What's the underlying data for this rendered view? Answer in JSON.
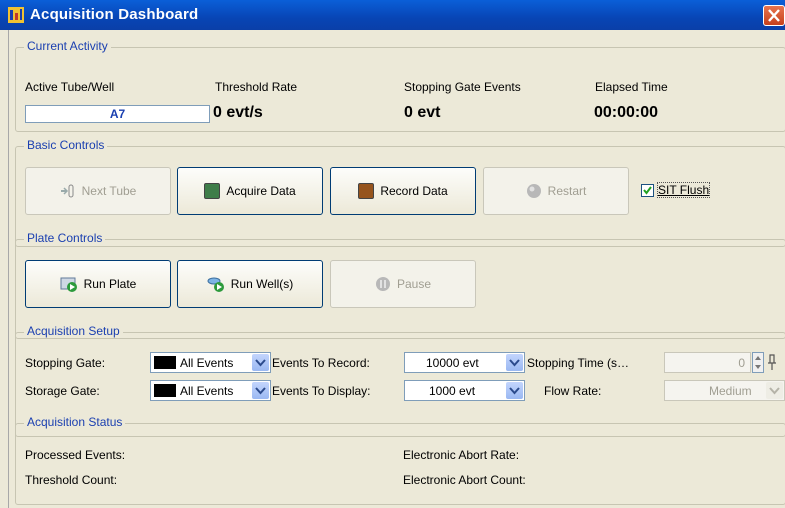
{
  "window": {
    "title": "Acquisition Dashboard"
  },
  "current_activity": {
    "legend": "Current Activity",
    "tube_label": "Active Tube/Well",
    "tube_value": "A7",
    "threshold_label": "Threshold Rate",
    "threshold_value": "0 evt/s",
    "stopping_label": "Stopping Gate Events",
    "stopping_value": "0 evt",
    "elapsed_label": "Elapsed Time",
    "elapsed_value": "00:00:00"
  },
  "basic_controls": {
    "legend": "Basic Controls",
    "next_tube": "Next Tube",
    "acquire": "Acquire Data",
    "record": "Record Data",
    "restart": "Restart",
    "sit_flush": "SIT Flush",
    "sit_flush_checked": true,
    "acquire_color": "#3f7d49",
    "record_color": "#96541d"
  },
  "plate_controls": {
    "legend": "Plate Controls",
    "run_plate": "Run Plate",
    "run_wells": "Run Well(s)",
    "pause": "Pause"
  },
  "acquisition_setup": {
    "legend": "Acquisition Setup",
    "stopping_gate_label": "Stopping Gate:",
    "stopping_gate_value": "All Events",
    "storage_gate_label": "Storage Gate:",
    "storage_gate_value": "All Events",
    "events_record_label": "Events To Record:",
    "events_record_value": "10000 evt",
    "events_display_label": "Events To Display:",
    "events_display_value": "1000 evt",
    "stopping_time_label": "Stopping Time (s…",
    "stopping_time_value": "0",
    "flow_rate_label": "Flow Rate:",
    "flow_rate_value": "Medium"
  },
  "acquisition_status": {
    "legend": "Acquisition Status",
    "processed_label": "Processed Events:",
    "threshold_count_label": "Threshold Count:",
    "abort_rate_label": "Electronic Abort Rate:",
    "abort_count_label": "Electronic Abort Count:"
  }
}
